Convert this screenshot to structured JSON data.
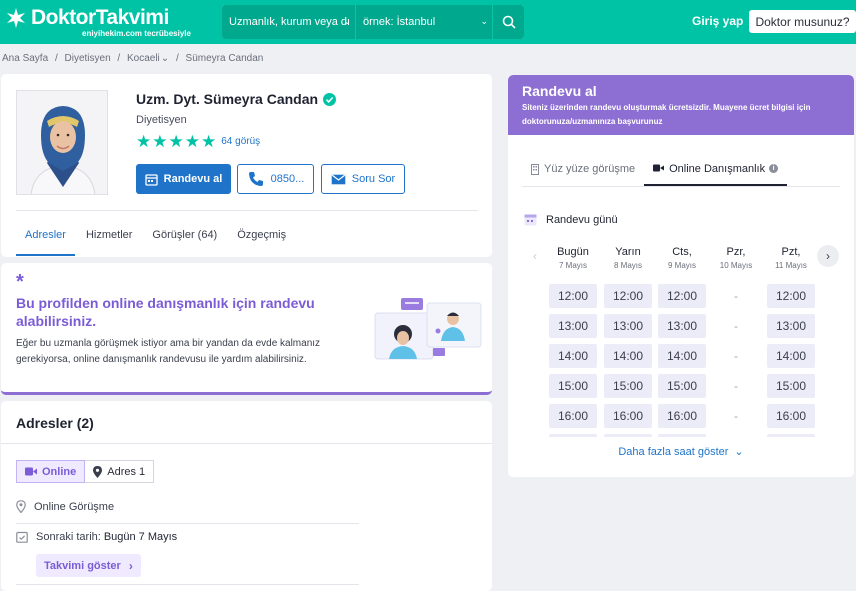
{
  "header": {
    "logo": "DoktorTakvimi",
    "logo_sub": "eniyihekim.com tecrübesiyle",
    "search_specialty_placeholder": "Uzmanlık, kurum veya dı",
    "search_location_placeholder": "örnek: İstanbul",
    "login": "Giriş yap",
    "doctor_button": "Doktor musunuz?"
  },
  "breadcrumb": [
    "Ana Sayfa",
    "/",
    "Diyetisyen",
    "/",
    "Kocaeli",
    "/",
    "Sümeyra Candan"
  ],
  "profile": {
    "name": "Uzm. Dyt. Sümeyra Candan",
    "specialty": "Diyetisyen",
    "rating": 5,
    "reviews": "64 görüş",
    "book_button": "Randevu al",
    "phone_button": "0850...",
    "ask_button": "Soru Sor",
    "tabs": [
      "Adresler",
      "Hizmetler",
      "Görüşler (64)",
      "Özgeçmiş"
    ],
    "active_tab": 0
  },
  "promo": {
    "title": "Bu profilden online danışmanlık için randevu alabilirsiniz.",
    "text": "Eğer bu uzmanla görüşmek istiyor ama bir yandan da evde kalmanız gerekiyorsa, online danışmanlık randevusu ile yardım alabilirsiniz."
  },
  "addresses": {
    "title": "Adresler (2)",
    "toggle_online": "Online",
    "toggle_address": "Adres 1",
    "location": "Online Görüşme",
    "next_date_label": "Sonraki tarih:",
    "next_date_value": "Bugün 7 Mayıs",
    "calendar_button": "Takvimi göster"
  },
  "booking": {
    "title": "Randevu al",
    "subtitle": "Siteniz üzerinden randevu oluşturmak ücretsizdir. Muayene ücret bilgisi için doktorunuza/uzmanınıza başvurunuz",
    "tabs": [
      "Yüz yüze görüşme",
      "Online Danışmanlık"
    ],
    "active_tab": 1,
    "day_label": "Randevu günü",
    "days": [
      {
        "name": "Bugün",
        "date": "7 Mayıs",
        "slots": [
          "12:00",
          "13:00",
          "14:00",
          "15:00",
          "16:00"
        ]
      },
      {
        "name": "Yarın",
        "date": "8 Mayıs",
        "slots": [
          "12:00",
          "13:00",
          "14:00",
          "15:00",
          "16:00"
        ]
      },
      {
        "name": "Cts,",
        "date": "9 Mayıs",
        "slots": [
          "12:00",
          "13:00",
          "14:00",
          "15:00",
          "16:00"
        ]
      },
      {
        "name": "Pzr,",
        "date": "10 Mayıs",
        "slots": [
          "-",
          "-",
          "-",
          "-",
          "-"
        ]
      },
      {
        "name": "Pzt,",
        "date": "11 Mayıs",
        "slots": [
          "12:00",
          "13:00",
          "14:00",
          "15:00",
          "16:00"
        ]
      }
    ],
    "more": "Daha fazla saat göster"
  },
  "colors": {
    "brand": "#00c3a5",
    "primary": "#1f74c9",
    "purple": "#8d6fd3"
  }
}
